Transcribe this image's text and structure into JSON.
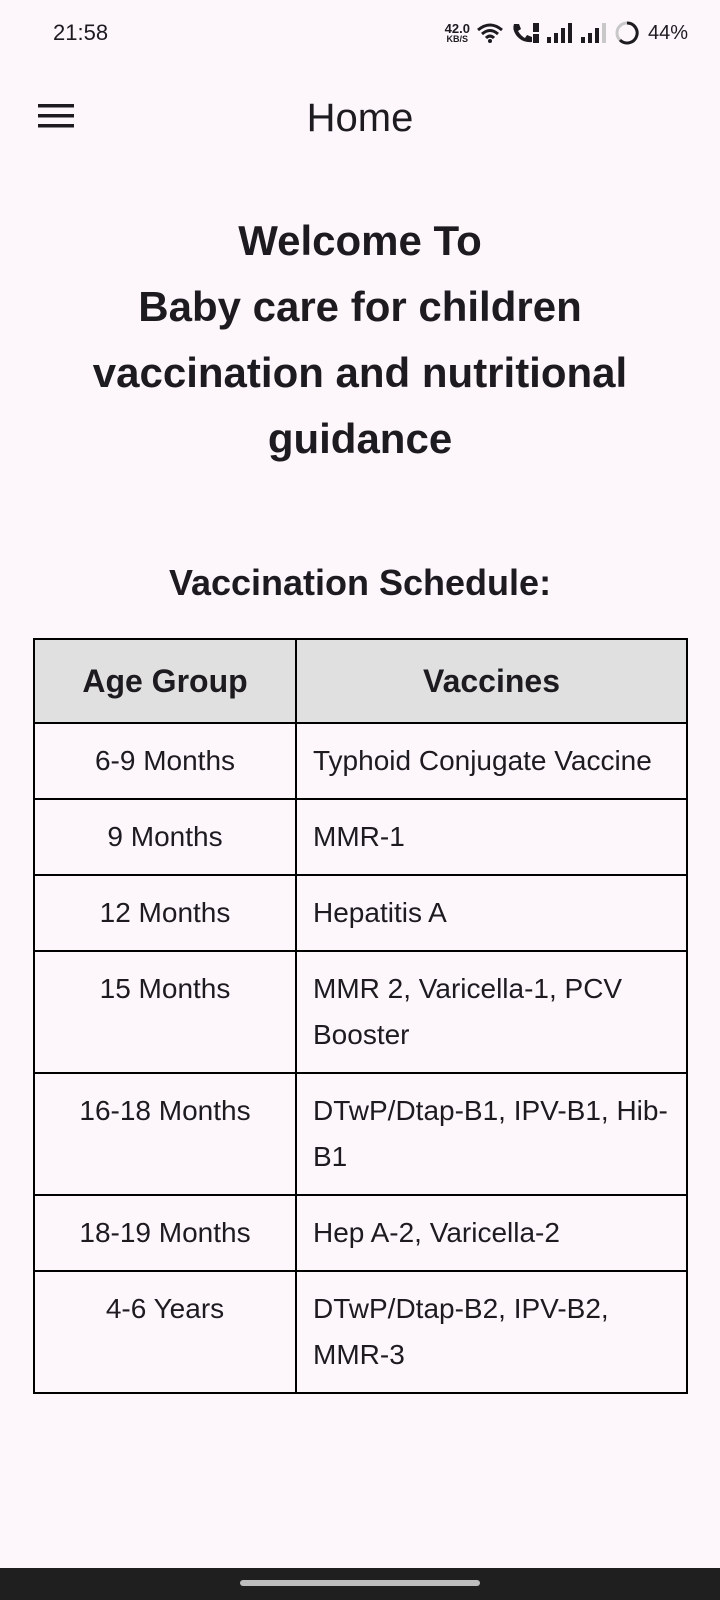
{
  "status_bar": {
    "time": "21:58",
    "net_speed_value": "42.0",
    "net_speed_unit": "KB/S",
    "battery": "44%"
  },
  "app_bar": {
    "title": "Home",
    "menu_icon": "hamburger-menu-icon"
  },
  "welcome": {
    "line1": "Welcome To",
    "line2": "Baby care for children",
    "line3": "vaccination and nutritional",
    "line4": "guidance"
  },
  "schedule": {
    "title": "Vaccination Schedule:",
    "headers": [
      "Age Group",
      "Vaccines"
    ],
    "rows": [
      {
        "age": "6-9 Months",
        "vaccines": "Typhoid Conjugate Vaccine"
      },
      {
        "age": "9 Months",
        "vaccines": "MMR-1"
      },
      {
        "age": "12 Months",
        "vaccines": "Hepatitis A"
      },
      {
        "age": "15 Months",
        "vaccines": "MMR 2, Varicella-1, PCV Booster"
      },
      {
        "age": "16-18 Months",
        "vaccines": "DTwP/Dtap-B1, IPV-B1, Hib-B1"
      },
      {
        "age": "18-19 Months",
        "vaccines": "Hep A-2, Varicella-2"
      },
      {
        "age": "4-6 Years",
        "vaccines": "DTwP/Dtap-B2, IPV-B2, MMR-3"
      }
    ]
  }
}
